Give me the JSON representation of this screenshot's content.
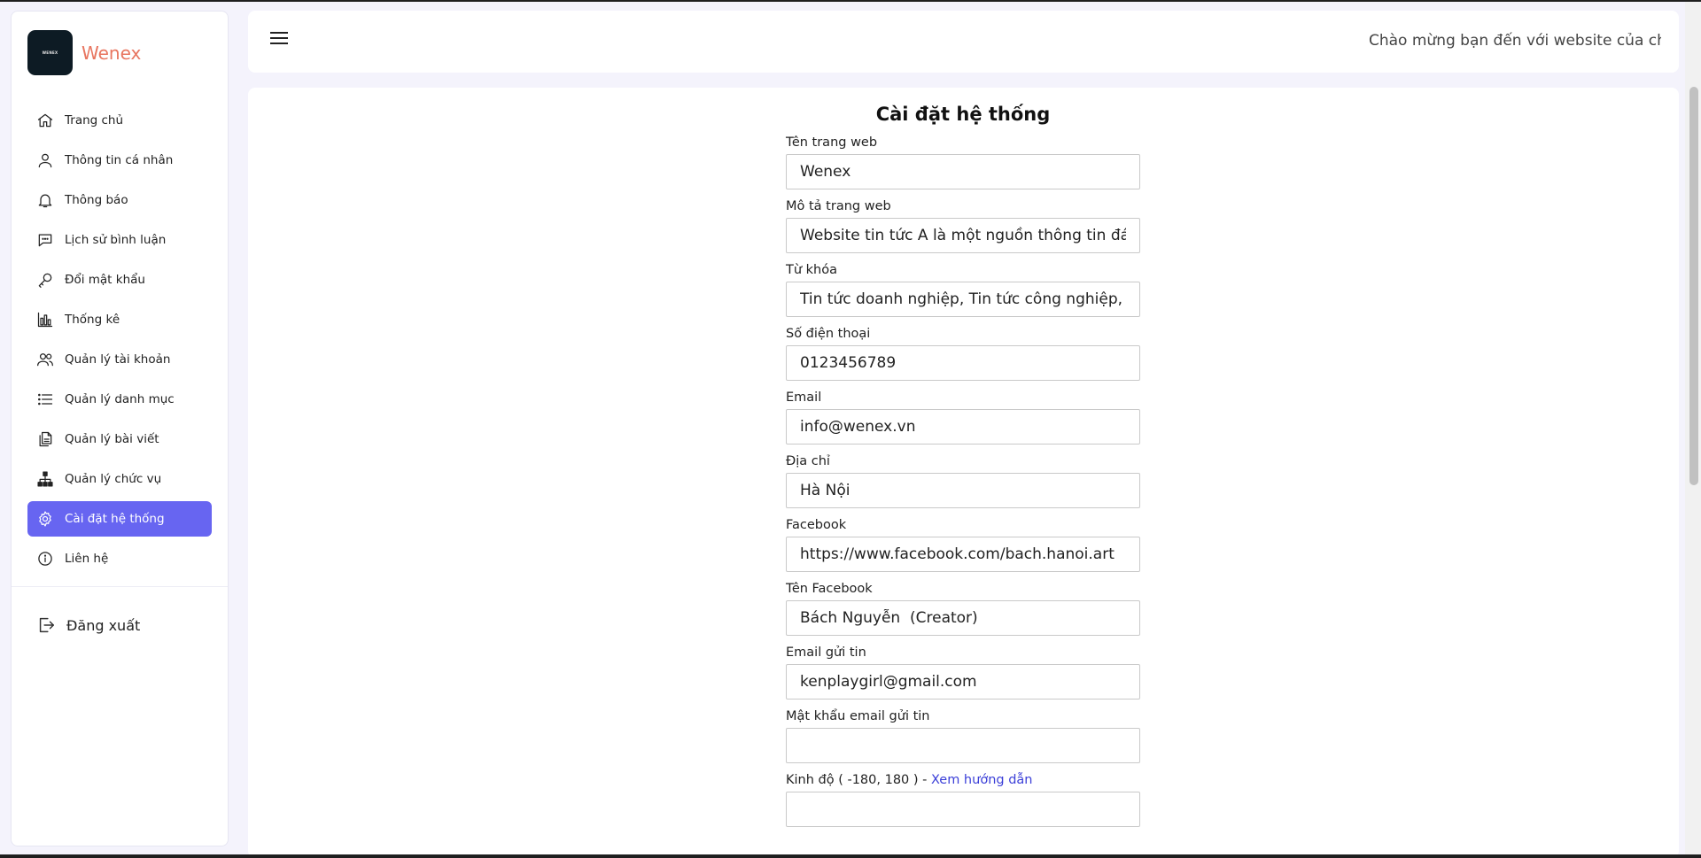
{
  "brand": {
    "logo_text": "WENEX",
    "name": "Wenex"
  },
  "sidebar": {
    "items": [
      {
        "label": "Trang chủ",
        "icon": "home-icon"
      },
      {
        "label": "Thông tin cá nhân",
        "icon": "user-icon"
      },
      {
        "label": "Thông báo",
        "icon": "bell-icon"
      },
      {
        "label": "Lịch sử bình luận",
        "icon": "comment-icon"
      },
      {
        "label": "Đổi mật khẩu",
        "icon": "key-icon"
      },
      {
        "label": "Thống kê",
        "icon": "bar-chart-icon"
      },
      {
        "label": "Quản lý tài khoản",
        "icon": "users-icon"
      },
      {
        "label": "Quản lý danh mục",
        "icon": "list-icon"
      },
      {
        "label": "Quản lý bài viết",
        "icon": "documents-icon"
      },
      {
        "label": "Quản lý chức vụ",
        "icon": "hierarchy-icon"
      },
      {
        "label": "Cài đặt hệ thống",
        "icon": "gear-icon",
        "active": true
      },
      {
        "label": "Liên hệ",
        "icon": "info-icon"
      }
    ],
    "logout_label": "Đăng xuất"
  },
  "header": {
    "welcome": "Chào mừng bạn đến với website của chúng tôi"
  },
  "form": {
    "title": "Cài đặt hệ thống",
    "fields": [
      {
        "label": "Tên trang web",
        "value": "Wenex"
      },
      {
        "label": "Mô tả trang web",
        "value": "Website tin tức A là một nguồn thông tin đáng tin cậy"
      },
      {
        "label": "Từ khóa",
        "value": "Tin tức doanh nghiệp, Tin tức công nghiệp, Phát triển"
      },
      {
        "label": "Số điện thoại",
        "value": "0123456789"
      },
      {
        "label": "Email",
        "value": "info@wenex.vn"
      },
      {
        "label": "Địa chỉ",
        "value": "Hà Nội"
      },
      {
        "label": "Facebook",
        "value": "https://www.facebook.com/bach.hanoi.art"
      },
      {
        "label": "Tên Facebook",
        "value": "Bách Nguyễn  (Creator)"
      },
      {
        "label": "Email gửi tin",
        "value": "kenplaygirl@gmail.com"
      },
      {
        "label": "Mật khẩu email gửi tin",
        "value": ""
      }
    ],
    "longitude": {
      "label": "Kinh độ ( -180, 180 ) - ",
      "link": "Xem hướng dẫn",
      "value": ""
    }
  },
  "colors": {
    "accent": "#6765f1",
    "brand": "#e8755f",
    "link": "#3b3fd8",
    "background": "#f4f3fc"
  }
}
